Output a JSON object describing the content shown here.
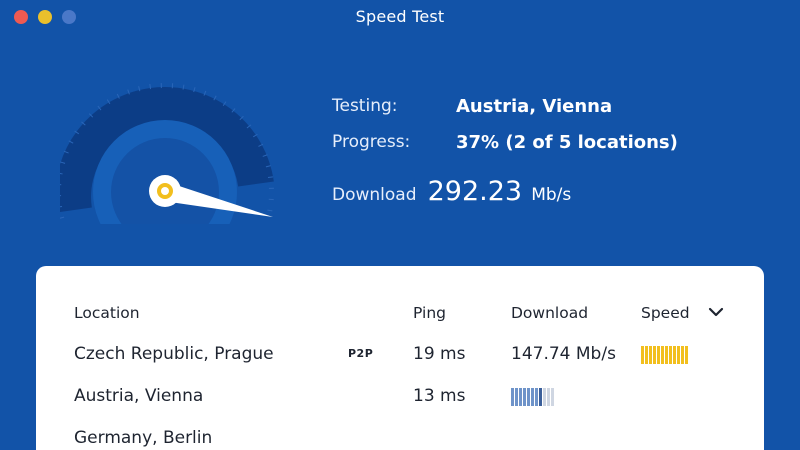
{
  "window": {
    "title": "Speed Test"
  },
  "status": {
    "testing_label": "Testing:",
    "testing_value": "Austria, Vienna",
    "progress_label": "Progress:",
    "progress_value": "37% (2 of 5 locations)",
    "progress_fraction": 0.37,
    "download_label": "Download",
    "download_value": "292.23",
    "download_unit": "Mb/s"
  },
  "table": {
    "headers": {
      "location": "Location",
      "ping": "Ping",
      "download": "Download",
      "speed": "Speed"
    },
    "rows": [
      {
        "location": "Czech Republic, Prague",
        "badge": "P2P",
        "ping": "19 ms",
        "download": "147.74 Mb/s",
        "speed_bars": {
          "total": 12,
          "filled": 12,
          "color": "#f2bf1e",
          "empty_color": "#f6e3a3"
        }
      },
      {
        "location": "Austria, Vienna",
        "badge": "",
        "ping": "13 ms",
        "download_bars": {
          "total": 11,
          "filled": 8,
          "color": "#6e93c9",
          "accent_color": "#3b5f9a",
          "empty_color": "#cfd6e2"
        }
      },
      {
        "location": "Germany, Berlin",
        "badge": "",
        "ping": "",
        "download": ""
      }
    ]
  },
  "colors": {
    "background": "#1253a8",
    "gauge_ring": "#0c3d86",
    "gauge_inner": "#1760b8",
    "needle_accent": "#f2bf1e"
  }
}
